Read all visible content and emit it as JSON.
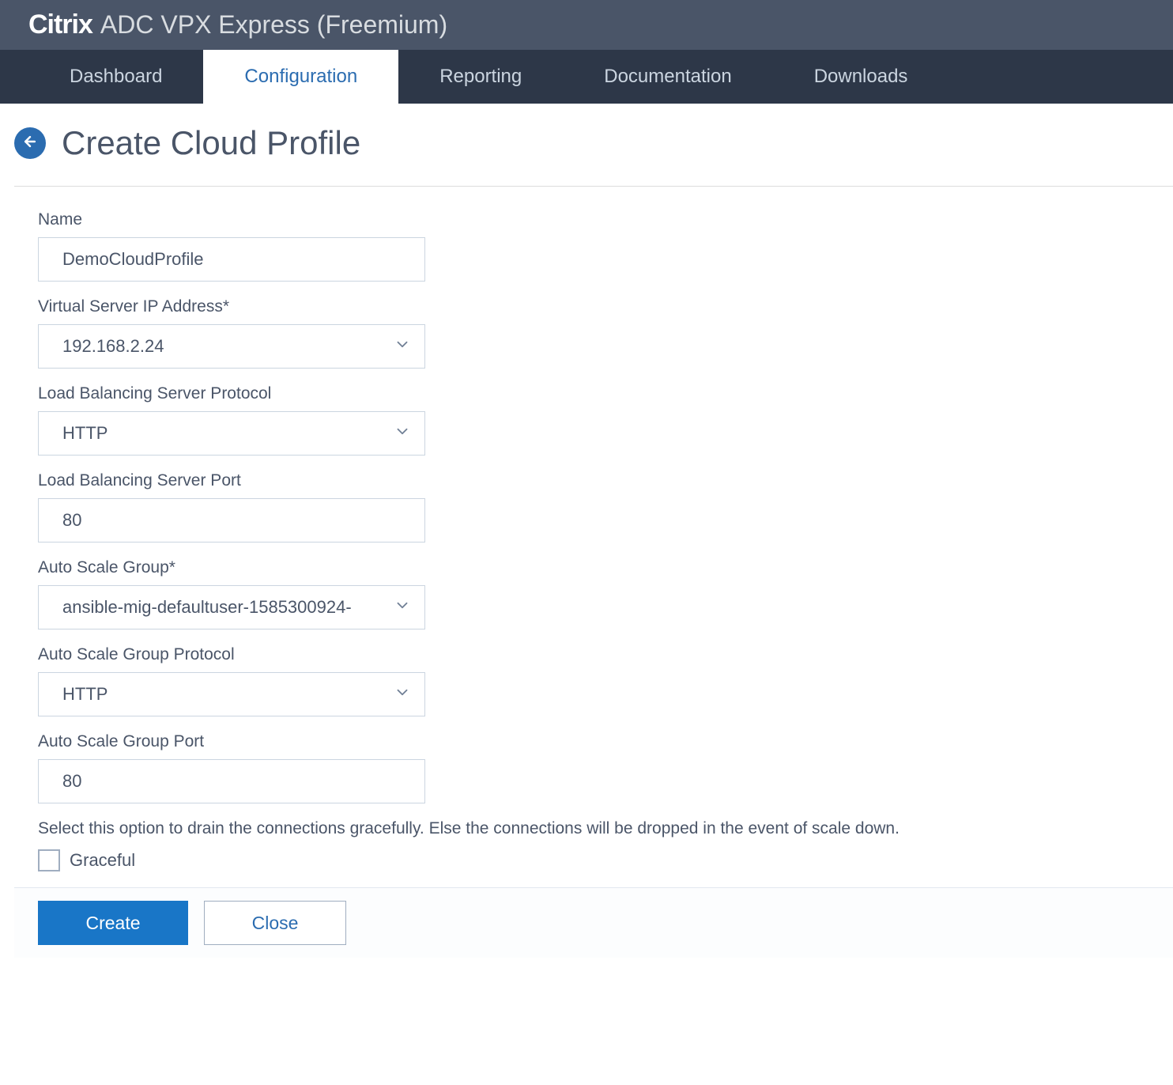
{
  "brand": {
    "logo": "Citrix",
    "suffix": "ADC VPX Express (Freemium)"
  },
  "tabs": [
    {
      "label": "Dashboard",
      "active": false
    },
    {
      "label": "Configuration",
      "active": true
    },
    {
      "label": "Reporting",
      "active": false
    },
    {
      "label": "Documentation",
      "active": false
    },
    {
      "label": "Downloads",
      "active": false
    }
  ],
  "page": {
    "title": "Create Cloud Profile"
  },
  "form": {
    "name": {
      "label": "Name",
      "value": "DemoCloudProfile"
    },
    "vip": {
      "label": "Virtual Server IP Address*",
      "value": "192.168.2.24"
    },
    "lb_protocol": {
      "label": "Load Balancing Server Protocol",
      "value": "HTTP"
    },
    "lb_port": {
      "label": "Load Balancing Server Port",
      "value": "80"
    },
    "asg": {
      "label": "Auto Scale Group*",
      "value": "ansible-mig-defaultuser-1585300924-"
    },
    "asg_protocol": {
      "label": "Auto Scale Group Protocol",
      "value": "HTTP"
    },
    "asg_port": {
      "label": "Auto Scale Group Port",
      "value": "80"
    },
    "graceful": {
      "helper": "Select this option to drain the connections gracefully. Else the connections will be dropped in the event of scale down.",
      "label": "Graceful",
      "checked": false
    }
  },
  "buttons": {
    "create": "Create",
    "close": "Close"
  }
}
